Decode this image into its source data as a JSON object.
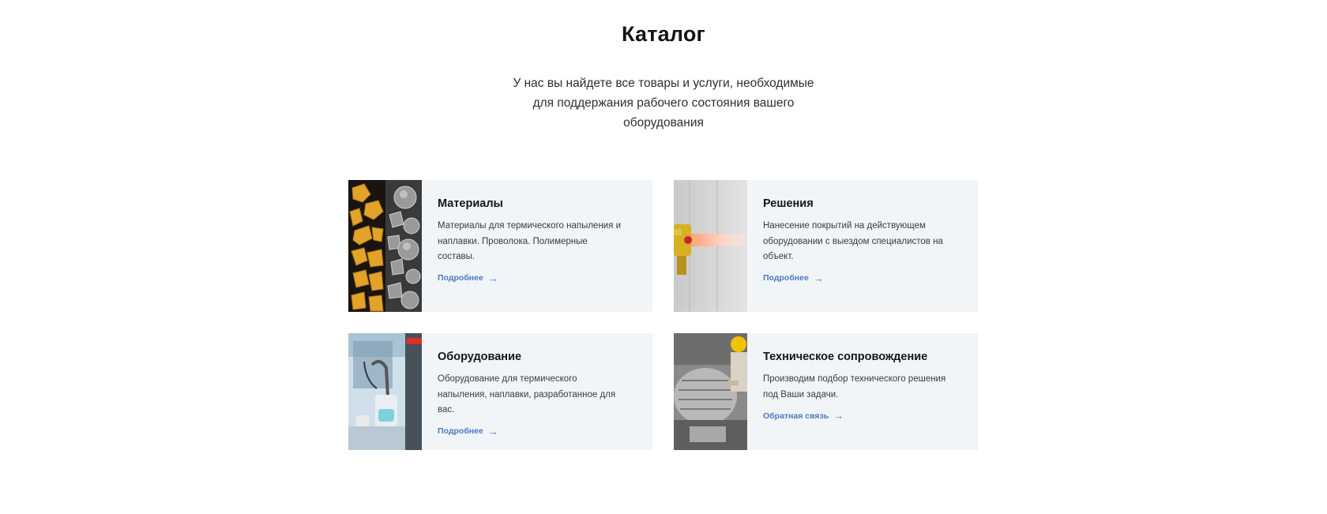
{
  "catalog": {
    "title": "Каталог",
    "subtitle": "У нас вы найдете все товары и услуги, необходимые для поддержания рабочего состояния вашего оборудования",
    "cards": [
      {
        "title": "Материалы",
        "text": "Материалы для термического напыления и наплавки. Проволока. Полимерные составы.",
        "link": "Подробнее",
        "image": "materials-photo"
      },
      {
        "title": "Решения",
        "text": "Нанесение покрытий на действующем оборудовании с выездом специалистов на объект.",
        "link": "Подробнее",
        "image": "solutions-photo"
      },
      {
        "title": "Оборудование",
        "text": "Оборудование для термического напыления, наплавки, разработанное для вас.",
        "link": "Подробнее",
        "image": "equipment-photo"
      },
      {
        "title": "Техническое сопровождение",
        "text": "Производим подбор технического решения под Ваши задачи.",
        "link": "Обратная связь",
        "image": "technical-support-photo"
      }
    ]
  },
  "colors": {
    "card_background": "#f1f5f8",
    "link": "#4d79c3",
    "title": "#141414"
  },
  "icons": {
    "link_arrow": "arrow-right-icon"
  }
}
